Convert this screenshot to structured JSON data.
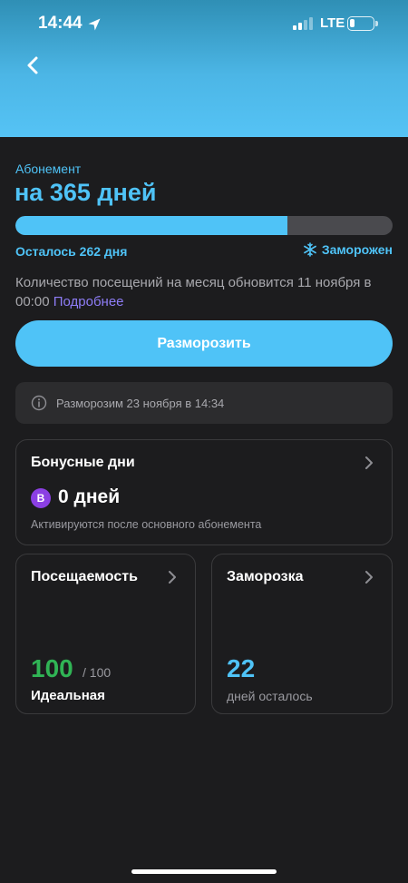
{
  "status_bar": {
    "time": "14:44",
    "network": "LTE",
    "signal_bars_active": 2,
    "signal_bars_total": 4,
    "battery_level": 0.2
  },
  "header": {
    "gradient_colors": [
      "#2f8fb5",
      "#55c3f5"
    ],
    "back_icon": "chevron-left-icon"
  },
  "subscription": {
    "label": "Абонемент",
    "title": "на 365 дней",
    "progress_fraction": 0.72,
    "remaining_text": "Осталось 262 дня",
    "status_icon": "snowflake-icon",
    "status_text": "Заморожен"
  },
  "visits_info": {
    "text": "Количество посещений на месяц обновится 11 ноября в 00:00",
    "link": "Подробнее"
  },
  "unfreeze_button": {
    "label": "Разморозить"
  },
  "notice": {
    "icon": "info-icon",
    "text": "Разморозим 23 ноября в 14:34"
  },
  "bonus_card": {
    "title": "Бонусные дни",
    "badge": "B",
    "days": "0 дней",
    "note": "Активируются после основного абонемента"
  },
  "attendance_card": {
    "title": "Посещаемость",
    "score": "100",
    "max": "/ 100",
    "label": "Идеальная"
  },
  "freeze_card": {
    "title": "Заморозка",
    "value": "22",
    "label": "дней осталось"
  },
  "colors": {
    "accent": "#4fc3f7",
    "link": "#8e7df6",
    "success": "#30b455",
    "badge": "#8b3fe3",
    "background": "#1c1c1e",
    "muted_text": "#a8a8ad"
  }
}
